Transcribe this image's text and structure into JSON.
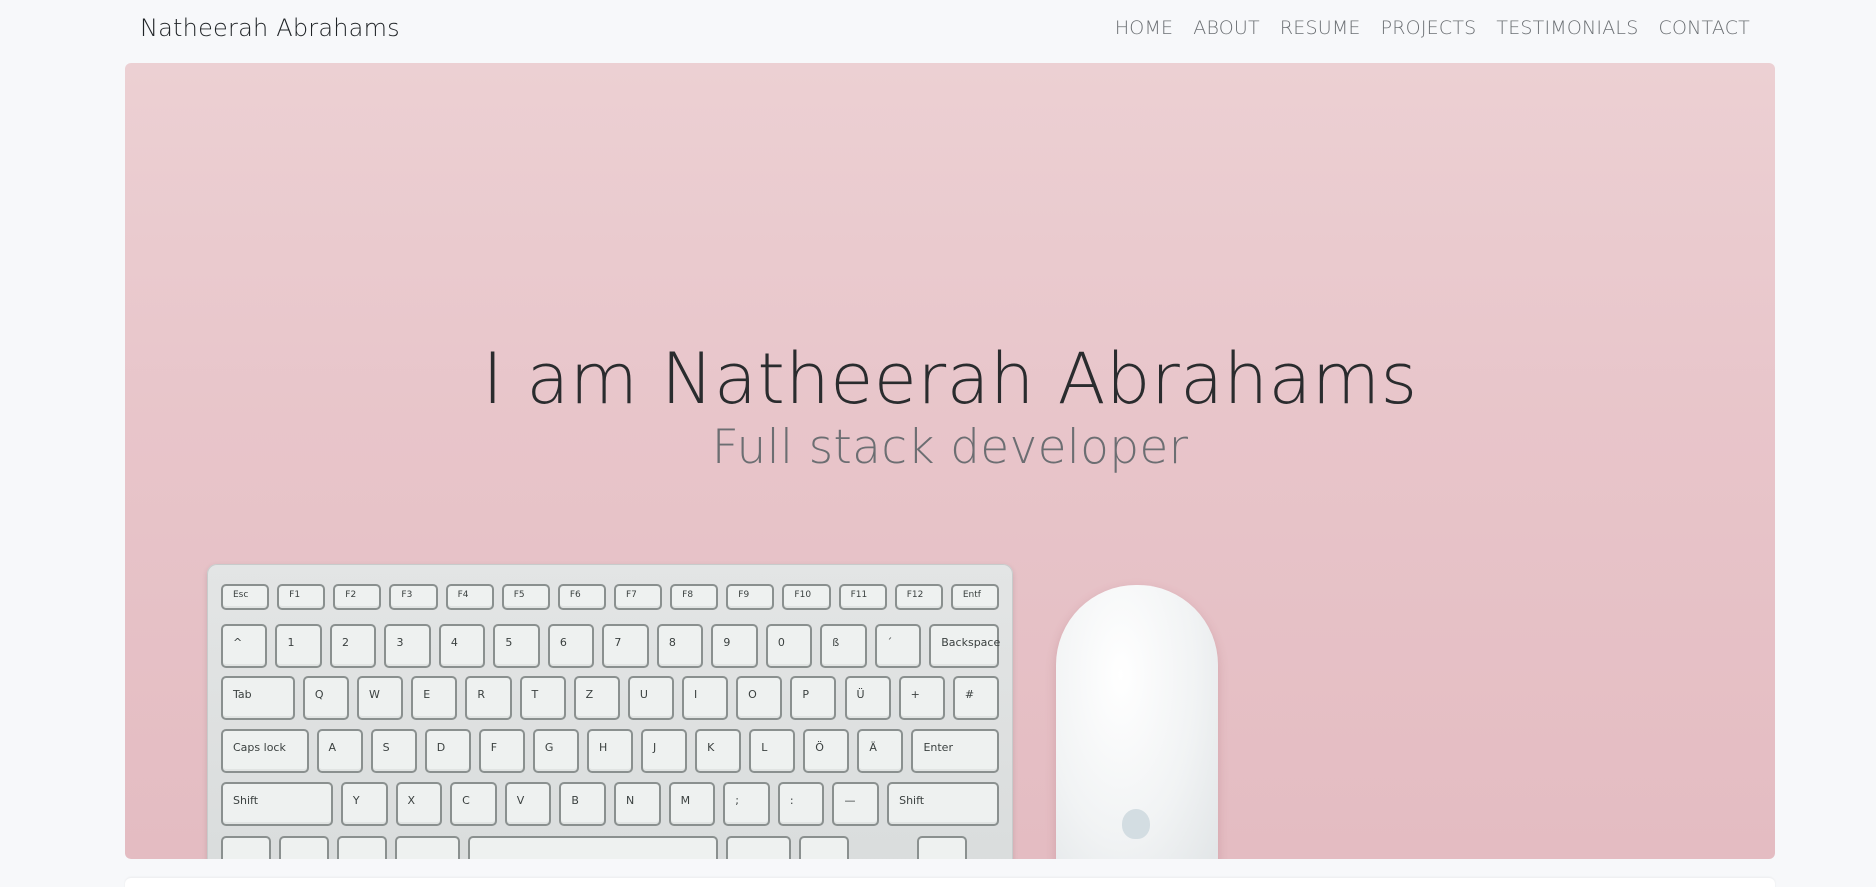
{
  "navbar": {
    "brand": "Natheerah Abrahams",
    "links": [
      "HOME",
      "ABOUT",
      "RESUME",
      "PROJECTS",
      "TESTIMONIALS",
      "CONTACT"
    ]
  },
  "hero": {
    "title": "I am Natheerah Abrahams",
    "subtitle": "Full stack developer"
  },
  "keyboard": {
    "row1": [
      "Esc",
      "F1",
      "F2",
      "F3",
      "F4",
      "F5",
      "F6",
      "F7",
      "F8",
      "F9",
      "F10",
      "F11",
      "F12",
      "Entf"
    ],
    "row2": [
      "^",
      "1",
      "2",
      "3",
      "4",
      "5",
      "6",
      "7",
      "8",
      "9",
      "0",
      "ß",
      "´",
      "Backspace"
    ],
    "row3": [
      "Tab",
      "Q",
      "W",
      "E",
      "R",
      "T",
      "Z",
      "U",
      "I",
      "O",
      "P",
      "Ü",
      "+",
      "#"
    ],
    "row4": [
      "Caps lock",
      "A",
      "S",
      "D",
      "F",
      "G",
      "H",
      "J",
      "K",
      "L",
      "Ö",
      "Ä",
      "Enter"
    ],
    "row5": [
      "Shift",
      "Y",
      "X",
      "C",
      "V",
      "B",
      "N",
      "M",
      ";",
      ":",
      "—",
      "Shift"
    ]
  },
  "colors": {
    "page_bg": "#f7f8fa",
    "hero_bg": "#e8c5ca",
    "nav_text": "#6b6f73"
  }
}
